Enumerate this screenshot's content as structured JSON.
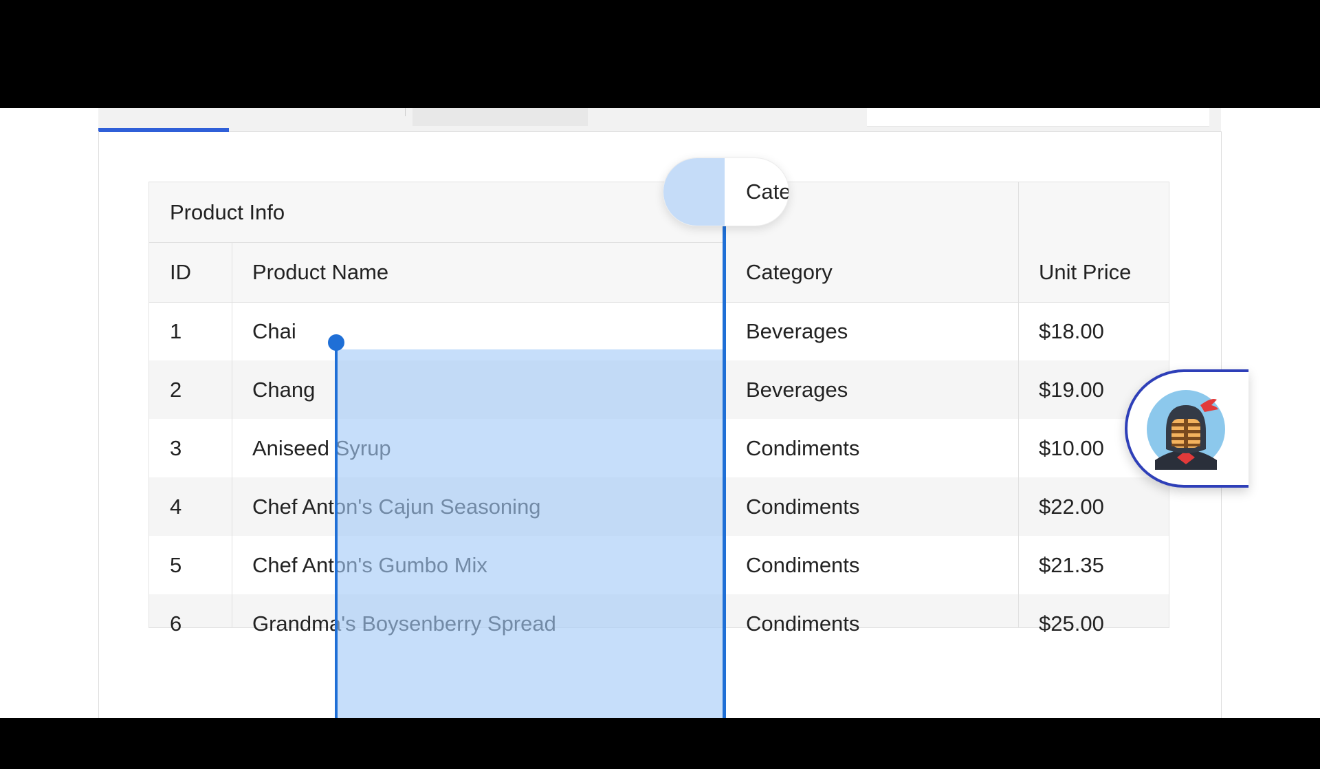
{
  "grid": {
    "group_header": "Product Info",
    "columns": [
      "ID",
      "Product Name",
      "Category",
      "Unit Price"
    ],
    "rows": [
      {
        "id": "1",
        "name": "Chai",
        "category": "Beverages",
        "price": "$18.00"
      },
      {
        "id": "2",
        "name": "Chang",
        "category": "Beverages",
        "price": "$19.00"
      },
      {
        "id": "3",
        "name": "Aniseed Syrup",
        "category": "Condiments",
        "price": "$10.00"
      },
      {
        "id": "4",
        "name": "Chef Anton's Cajun Seasoning",
        "category": "Condiments",
        "price": "$22.00"
      },
      {
        "id": "5",
        "name": "Chef Anton's Gumbo Mix",
        "category": "Condiments",
        "price": "$21.35"
      },
      {
        "id": "6",
        "name": "Grandma's Boysenberry Spread",
        "category": "Condiments",
        "price": "$25.00"
      }
    ]
  },
  "drag_header": {
    "label": "Cate"
  },
  "avatar": {
    "icon": "kendo-ninja-icon"
  },
  "colors": {
    "accent": "#1f6fd6",
    "selection": "#a3c9f7",
    "tab_indicator": "#2f5fd8",
    "avatar_border": "#2e3fb8",
    "alt_row": "#f5f5f5",
    "header_bg": "#f7f7f7"
  }
}
